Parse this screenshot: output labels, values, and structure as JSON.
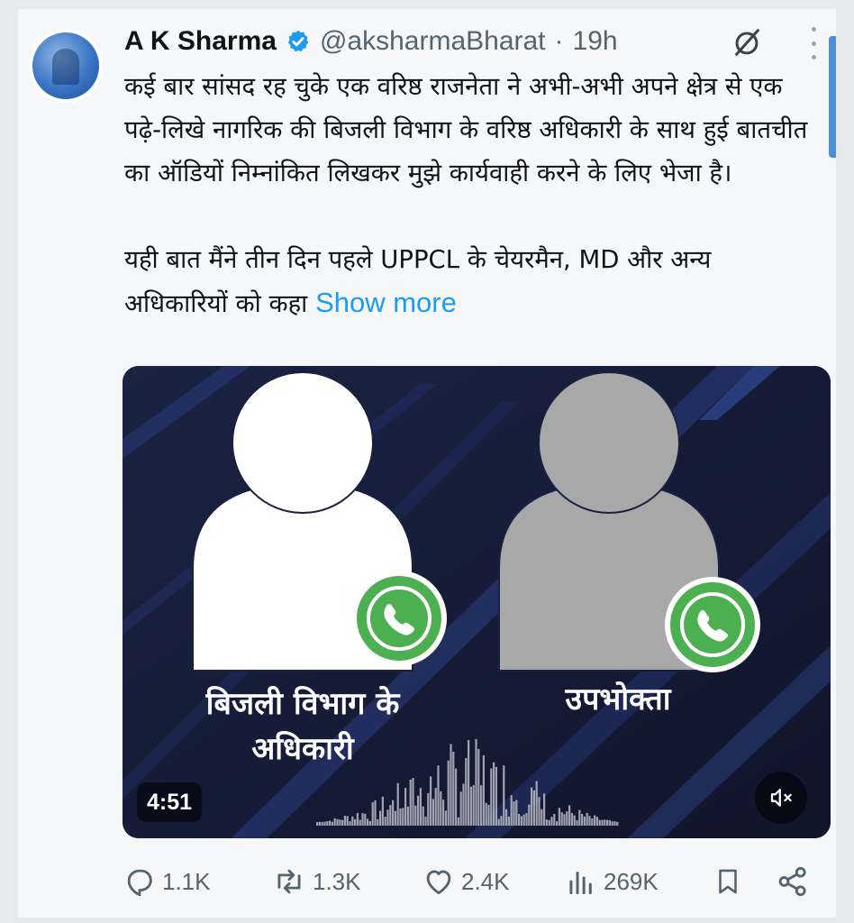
{
  "author": {
    "name": "A K Sharma",
    "handle": "@aksharmaBharat",
    "separator": "·",
    "time": "19h"
  },
  "tweet": {
    "paragraph1": "कई बार सांसद रह चुके एक वरिष्ठ राजनेता ने अभी-अभी अपने क्षेत्र से एक पढ़े-लिखे नागरिक की बिजली विभाग के वरिष्ठ अधिकारी के साथ हुई बातचीत का ऑडियों निम्नांकित  लिखकर मुझे कार्यवाही करने के लिए भेजा है।",
    "paragraph2": "यही बात मैंने तीन दिन पहले UPPCL के  चेयरमैन, MD और अन्य अधिकारियों को कहा",
    "show_more": "Show more"
  },
  "media": {
    "left_label": "बिजली विभाग के अधिकारी",
    "right_label": "उपभोक्ता",
    "duration": "4:51",
    "accent_green": "#4caf50"
  },
  "actions": {
    "replies": "1.1K",
    "reposts": "1.3K",
    "likes": "2.4K",
    "views": "269K"
  },
  "colors": {
    "link": "#1d9bf0",
    "muted": "#536471",
    "verified": "#1d9bf0"
  }
}
